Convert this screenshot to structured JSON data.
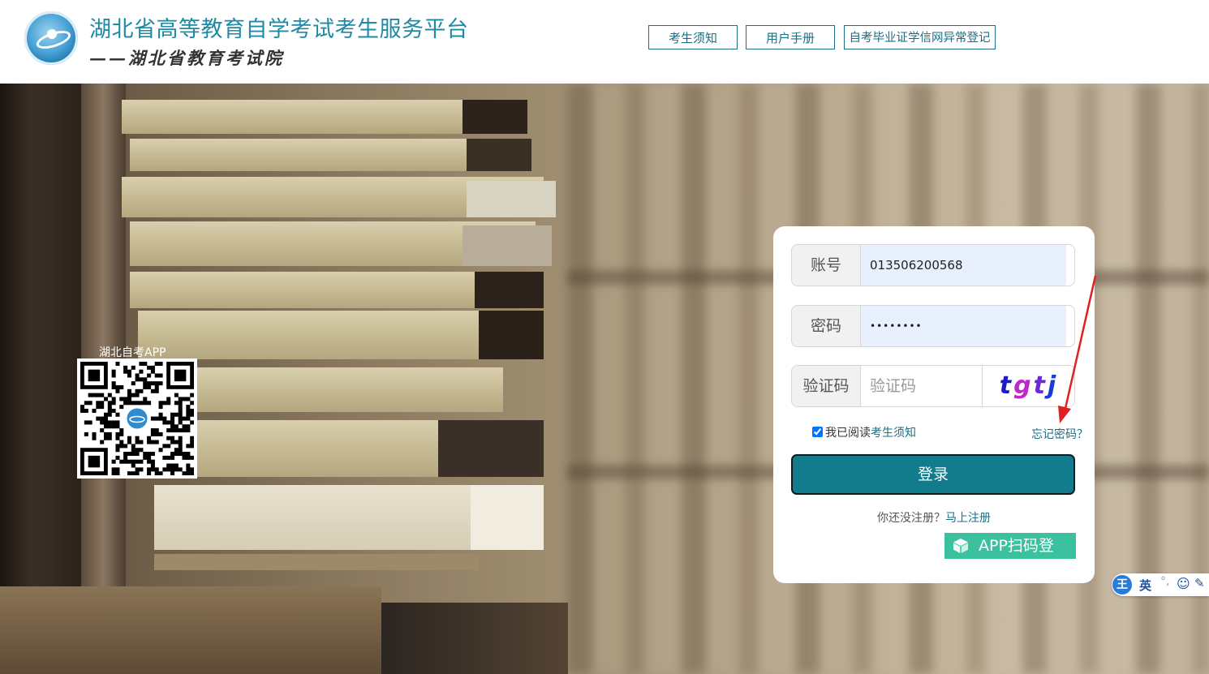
{
  "header": {
    "title": "湖北省高等教育自学考试考生服务平台",
    "subtitle": "——湖北省教育考试院",
    "nav": [
      {
        "label": "考生须知"
      },
      {
        "label": "用户手册"
      },
      {
        "label": "自考毕业证学信网异常登记"
      }
    ]
  },
  "qr": {
    "label": "湖北自考APP"
  },
  "login": {
    "account_label": "账号",
    "account_value": "013506200568",
    "password_label": "密码",
    "password_value": "••••••••",
    "captcha_label": "验证码",
    "captcha_placeholder": "验证码",
    "captcha_chars": [
      "t",
      "g",
      "t",
      "j"
    ],
    "agree_checked": true,
    "agree_text": "我已阅读",
    "agree_link": "考生须知",
    "forgot_label": "忘记密码？",
    "submit_label": "登录",
    "register_prompt": "你还没注册？",
    "register_link": "马上注册",
    "app_login_label": "APP扫码登"
  },
  "ime_toolbar": {
    "logo": "王",
    "mode": "英",
    "punct": "°,",
    "emoji_icon": "smiley-icon",
    "pen_icon": "pen-icon"
  },
  "colors": {
    "brand": "#1a6f86",
    "login_button": "#127b8c",
    "app_button": "#3cc1a0",
    "annotation_arrow": "#e02020"
  }
}
